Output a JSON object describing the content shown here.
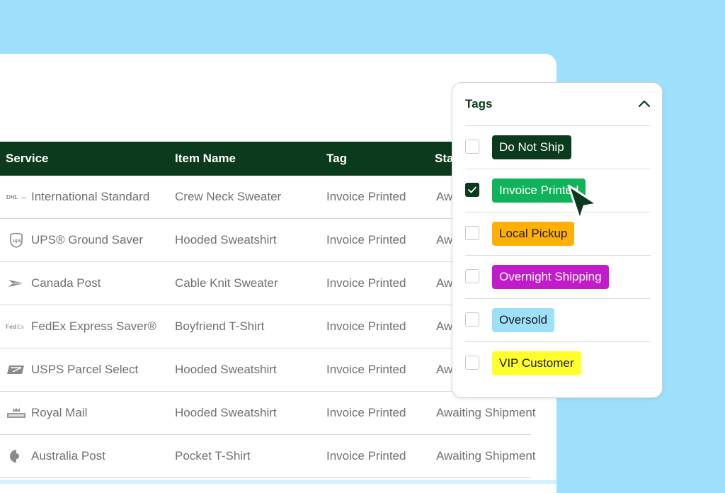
{
  "table": {
    "headers": {
      "service": "Service",
      "item_name": "Item Name",
      "tag": "Tag",
      "status": "Sta"
    },
    "rows": [
      {
        "carrier_icon": "dhl-logo-icon",
        "service": "International Standard",
        "item": "Crew Neck Sweater",
        "tag": "Invoice Printed",
        "status": "Aw"
      },
      {
        "carrier_icon": "ups-logo-icon",
        "service": "UPS® Ground Saver",
        "item": "Hooded Sweatshirt",
        "tag": "Invoice Printed",
        "status": "Aw"
      },
      {
        "carrier_icon": "canada-post-logo-icon",
        "service": "Canada Post",
        "item": "Cable Knit Sweater",
        "tag": "Invoice Printed",
        "status": "Aw"
      },
      {
        "carrier_icon": "fedex-logo-icon",
        "service": "FedEx Express Saver®",
        "item": "Boyfriend T-Shirt",
        "tag": "Invoice Printed",
        "status": "Aw"
      },
      {
        "carrier_icon": "usps-logo-icon",
        "service": "USPS Parcel Select",
        "item": "Hooded Sweatshirt",
        "tag": "Invoice Printed",
        "status": "Aw"
      },
      {
        "carrier_icon": "royal-mail-logo-icon",
        "service": "Royal Mail",
        "item": "Hooded Sweatshirt",
        "tag": "Invoice Printed",
        "status": "Awaiting Shipment"
      },
      {
        "carrier_icon": "australia-post-logo-icon",
        "service": "Australia Post",
        "item": "Pocket T-Shirt",
        "tag": "Invoice Printed",
        "status": "Awaiting Shipment"
      }
    ]
  },
  "dropdown": {
    "title": "Tags",
    "chevron_icon": "chevron-up-icon",
    "options": [
      {
        "label": "Do Not Ship",
        "checked": false,
        "bg": "#0b3a1c",
        "fg": "#ffffff"
      },
      {
        "label": "Invoice Printed",
        "checked": true,
        "bg": "#10b35a",
        "fg": "#ffffff"
      },
      {
        "label": "Local Pickup",
        "checked": false,
        "bg": "#ffb000",
        "fg": "#1a1a1a"
      },
      {
        "label": "Overnight Shipping",
        "checked": false,
        "bg": "#c21bc9",
        "fg": "#ffffff"
      },
      {
        "label": "Oversold",
        "checked": false,
        "bg": "#9ee0fb",
        "fg": "#1a1a1a"
      },
      {
        "label": "VIP Customer",
        "checked": false,
        "bg": "#ffff2e",
        "fg": "#1a1a1a"
      }
    ]
  },
  "colors": {
    "background": "#9ee0fb",
    "header_bg": "#0b3a1c",
    "cursor": "#0b3a1c"
  }
}
